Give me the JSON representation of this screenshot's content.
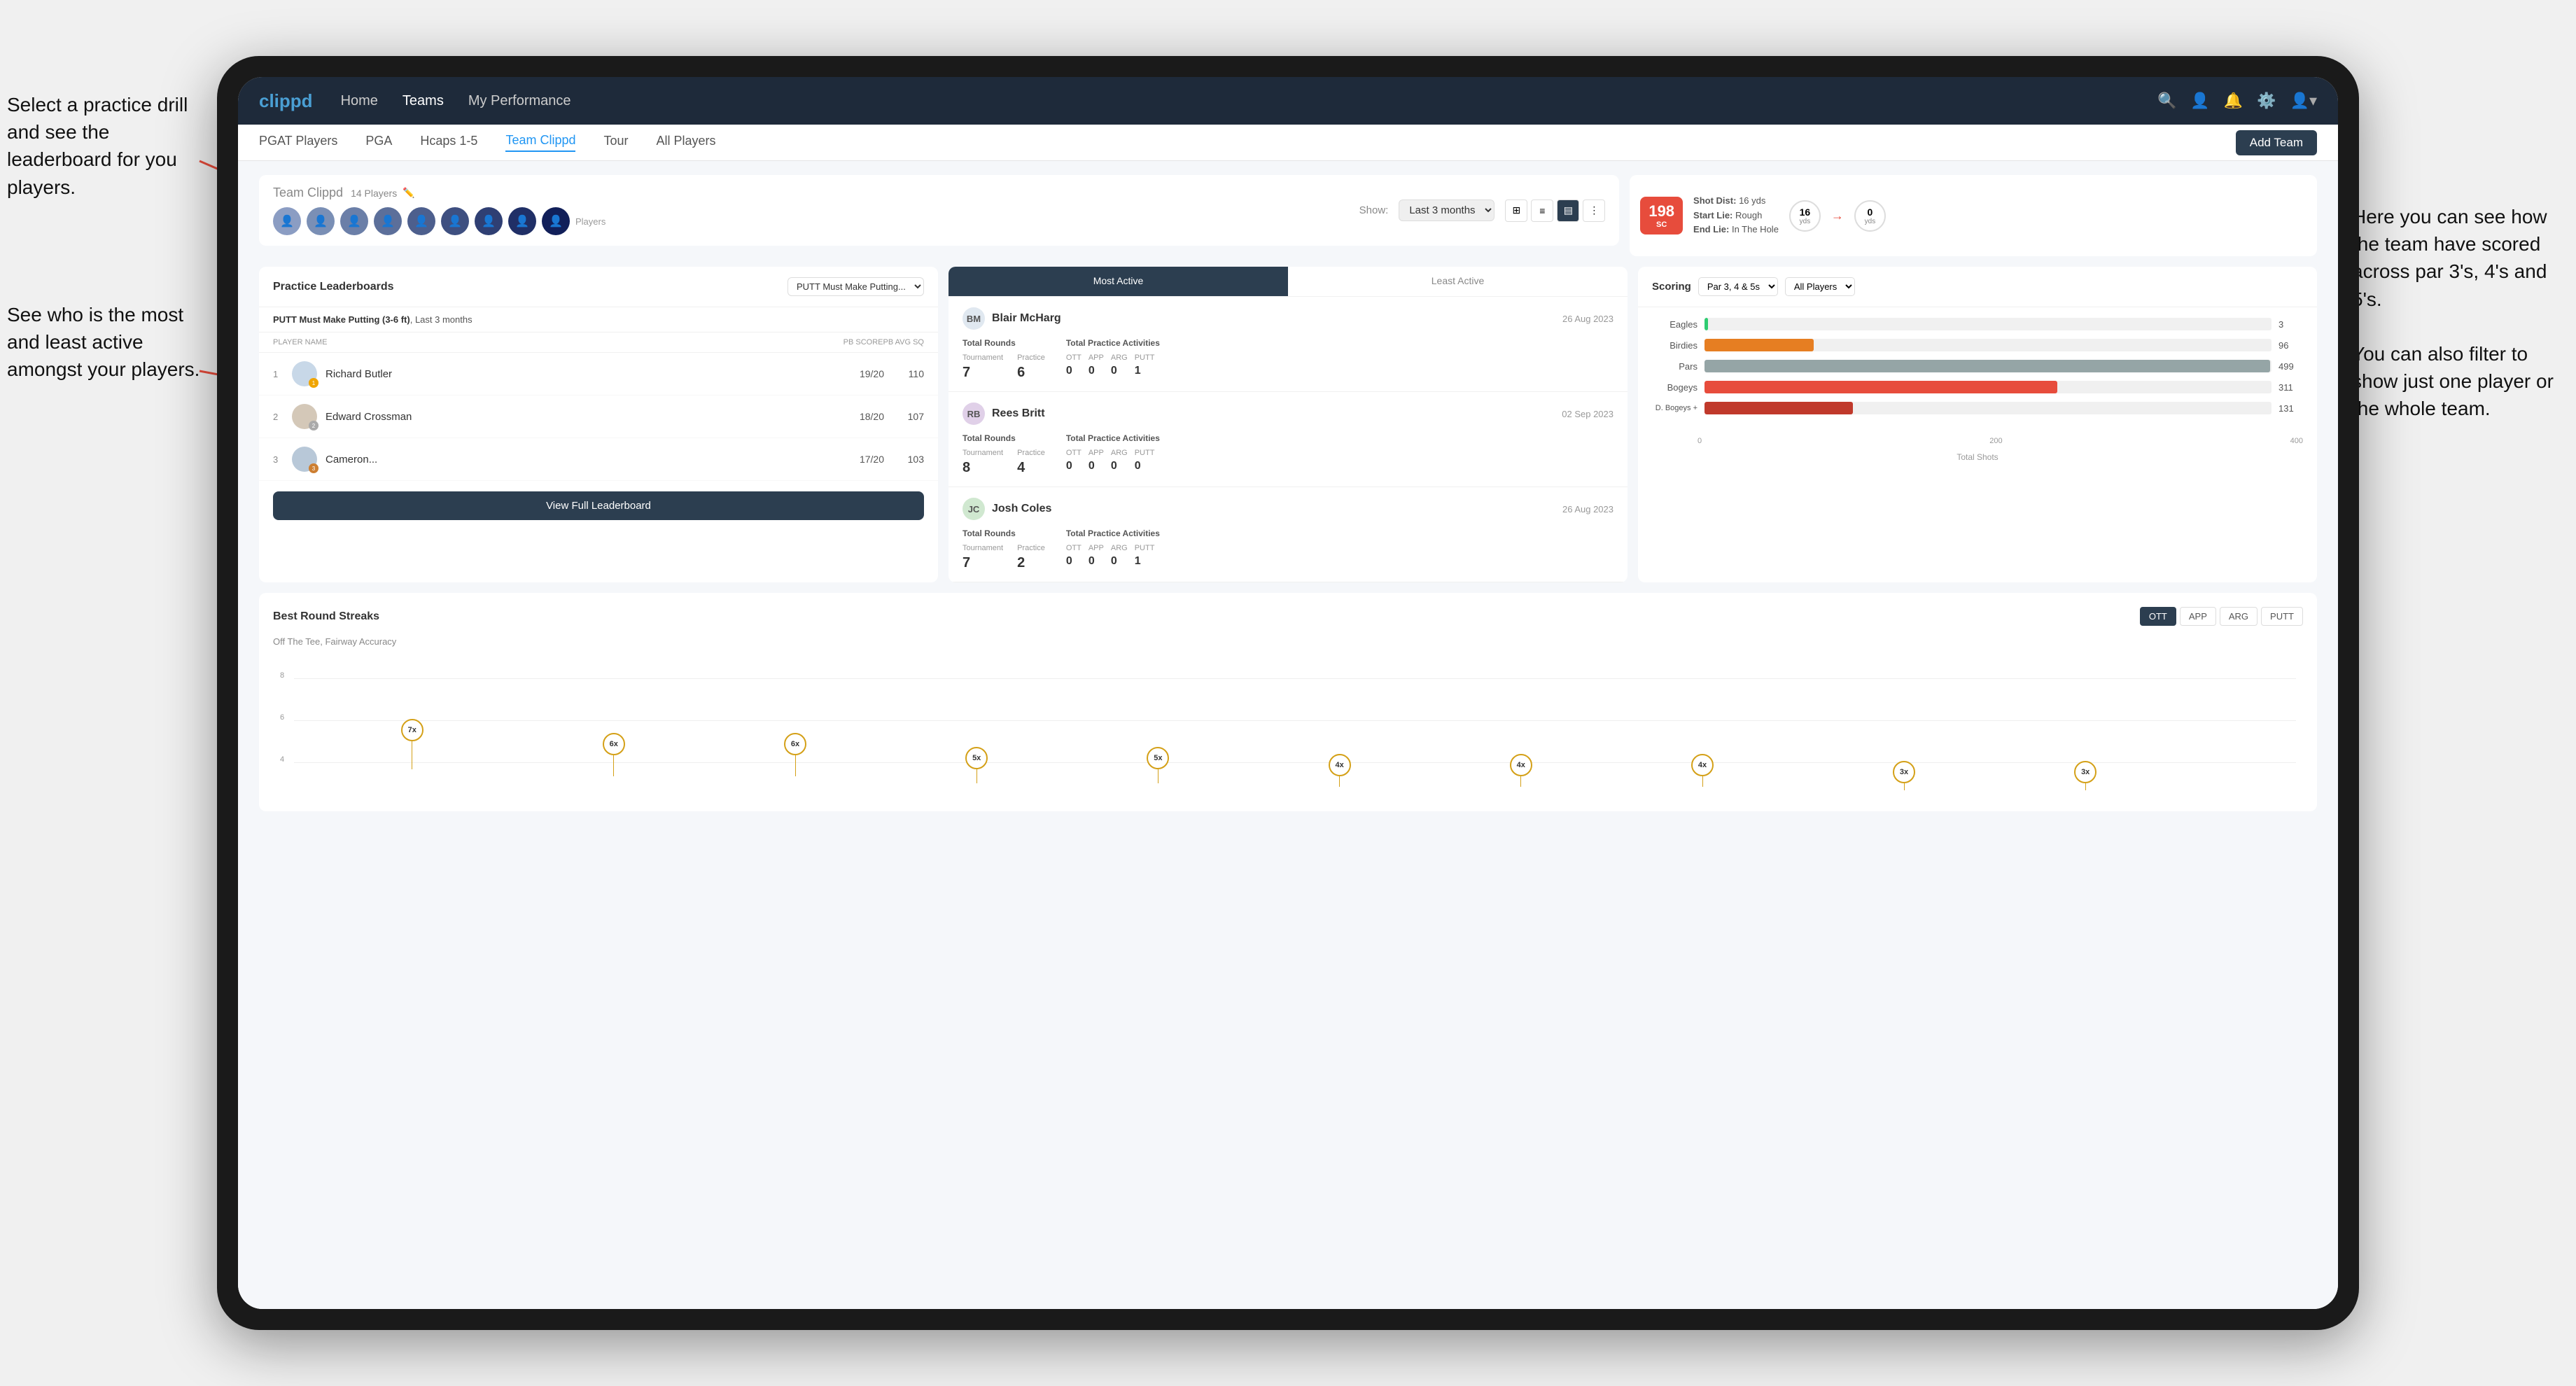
{
  "annotations": {
    "left1": "Select a practice drill and see the leaderboard for you players.",
    "left2": "See who is the most and least active amongst your players.",
    "right": "Here you can see how the team have scored across par 3's, 4's and 5's.\n\nYou can also filter to show just one player or the whole team."
  },
  "nav": {
    "logo": "clippd",
    "items": [
      "Home",
      "Teams",
      "My Performance"
    ],
    "icons": [
      "search",
      "person",
      "bell",
      "settings",
      "user"
    ],
    "active": "Teams"
  },
  "subnav": {
    "items": [
      "PGAT Players",
      "PGA",
      "Hcaps 1-5",
      "Team Clippd",
      "Tour",
      "All Players"
    ],
    "active": "Team Clippd",
    "add_button": "Add Team"
  },
  "team_header": {
    "title": "Team Clippd",
    "count": "14 Players",
    "show_label": "Show:",
    "show_value": "Last 3 months",
    "players_label": "Players"
  },
  "shot_card": {
    "badge_num": "198",
    "badge_unit": "SC",
    "shot_dist_label": "Shot Dist:",
    "shot_dist_val": "16 yds",
    "start_lie_label": "Start Lie:",
    "start_lie_val": "Rough",
    "end_lie_label": "End Lie:",
    "end_lie_val": "In The Hole",
    "yard1": "16",
    "yard1_unit": "yds",
    "yard2": "0",
    "yard2_unit": "yds"
  },
  "leaderboard": {
    "title": "Practice Leaderboards",
    "drill_name": "PUTT Must Make Putting...",
    "subtitle_drill": "PUTT Must Make Putting (3-6 ft)",
    "subtitle_period": "Last 3 months",
    "col_player": "PLAYER NAME",
    "col_score": "PB SCORE",
    "col_avg": "PB AVG SQ",
    "players": [
      {
        "rank": 1,
        "name": "Richard Butler",
        "score": "19/20",
        "avg": "110",
        "badge": "gold",
        "badge_num": "1"
      },
      {
        "rank": 2,
        "name": "Edward Crossman",
        "score": "18/20",
        "avg": "107",
        "badge": "silver",
        "badge_num": "2"
      },
      {
        "rank": 3,
        "name": "Cameron...",
        "score": "17/20",
        "avg": "103",
        "badge": "bronze",
        "badge_num": "3"
      }
    ],
    "view_full_btn": "View Full Leaderboard"
  },
  "activity": {
    "tab_active": "Most Active",
    "tab_inactive": "Least Active",
    "players": [
      {
        "name": "Blair McHarg",
        "date": "26 Aug 2023",
        "total_rounds_label": "Total Rounds",
        "tournament_label": "Tournament",
        "tournament_val": "7",
        "practice_label": "Practice",
        "practice_val": "6",
        "total_practice_label": "Total Practice Activities",
        "ott_label": "OTT",
        "ott_val": "0",
        "app_label": "APP",
        "app_val": "0",
        "arg_label": "ARG",
        "arg_val": "0",
        "putt_label": "PUTT",
        "putt_val": "1"
      },
      {
        "name": "Rees Britt",
        "date": "02 Sep 2023",
        "total_rounds_label": "Total Rounds",
        "tournament_label": "Tournament",
        "tournament_val": "8",
        "practice_label": "Practice",
        "practice_val": "4",
        "total_practice_label": "Total Practice Activities",
        "ott_label": "OTT",
        "ott_val": "0",
        "app_label": "APP",
        "app_val": "0",
        "arg_label": "ARG",
        "arg_val": "0",
        "putt_label": "PUTT",
        "putt_val": "0"
      },
      {
        "name": "Josh Coles",
        "date": "26 Aug 2023",
        "total_rounds_label": "Total Rounds",
        "tournament_label": "Tournament",
        "tournament_val": "7",
        "practice_label": "Practice",
        "practice_val": "2",
        "total_practice_label": "Total Practice Activities",
        "ott_label": "OTT",
        "ott_val": "0",
        "app_label": "APP",
        "app_val": "0",
        "arg_label": "ARG",
        "arg_val": "0",
        "putt_label": "PUTT",
        "putt_val": "1"
      }
    ]
  },
  "scoring": {
    "label": "Scoring",
    "filter1": "Par 3, 4 & 5s",
    "filter2": "All Players",
    "bars": [
      {
        "label": "Eagles",
        "value": 3,
        "max": 500,
        "type": "eagles"
      },
      {
        "label": "Birdies",
        "value": 96,
        "max": 500,
        "type": "birdies"
      },
      {
        "label": "Pars",
        "value": 499,
        "max": 500,
        "type": "pars"
      },
      {
        "label": "Bogeys",
        "value": 311,
        "max": 500,
        "type": "bogeys"
      },
      {
        "label": "D. Bogeys +",
        "value": 131,
        "max": 500,
        "type": "dbogeys"
      }
    ],
    "axis_labels": [
      "0",
      "200",
      "400"
    ],
    "axis_title": "Total Shots"
  },
  "best_round_streaks": {
    "title": "Best Round Streaks",
    "subtitle": "Off The Tee, Fairway Accuracy",
    "buttons": [
      "OTT",
      "APP",
      "ARG",
      "PUTT"
    ],
    "active_button": "OTT",
    "pins": [
      {
        "count": "7x",
        "left_pct": 8
      },
      {
        "count": "6x",
        "left_pct": 17
      },
      {
        "count": "6x",
        "left_pct": 26
      },
      {
        "count": "5x",
        "left_pct": 35
      },
      {
        "count": "5x",
        "left_pct": 44
      },
      {
        "count": "4x",
        "left_pct": 53
      },
      {
        "count": "4x",
        "left_pct": 62
      },
      {
        "count": "4x",
        "left_pct": 71
      },
      {
        "count": "3x",
        "left_pct": 80
      },
      {
        "count": "3x",
        "left_pct": 89
      }
    ]
  },
  "colors": {
    "primary": "#1e2a3a",
    "accent": "#2196f3",
    "gold": "#f0a500",
    "silver": "#aaaaaa",
    "bronze": "#cd7f32",
    "danger": "#e74c3c"
  }
}
